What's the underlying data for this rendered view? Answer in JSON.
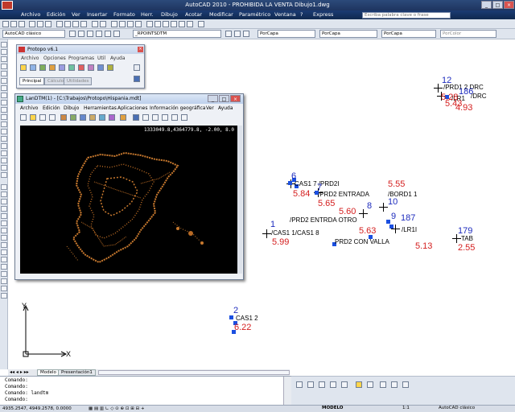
{
  "window": {
    "title": "AutoCAD 2010 - PROHIBIDA LA VENTA    Dibujo1.dwg",
    "search_placeholder": "Escriba palabra clave o frase"
  },
  "menu": [
    "Archivo",
    "Edición",
    "Ver",
    "Insertar",
    "Formato",
    "Herr.",
    "Dibujo",
    "Acotar",
    "Modificar",
    "Paramétrico",
    "Ventana",
    "?",
    "Express"
  ],
  "toolbar": {
    "workspace": "AutoCAD clásico",
    "layer": "_RPOINTSDTM",
    "layer_combo": "PorCapa",
    "linetype": "PorCapa",
    "lineweight": "PorCapa",
    "color": "PorColor"
  },
  "protopo": {
    "title": "Protopo v6.1",
    "menu": [
      "Archivo",
      "Opciones",
      "Programas",
      "Util",
      "Ayuda"
    ],
    "tabs": [
      "Principal",
      "Cálculo",
      "Utilidades"
    ]
  },
  "landtm": {
    "title": "LanDTM(1) - [C:\\Trabajos\\Protopo\\Hispania.mdt]",
    "menu": [
      "Archivo",
      "Edición",
      "Dibujo",
      "Herramientas",
      "Aplicaciones",
      "Información geográfica",
      "Ver",
      "Ayuda"
    ],
    "coords": "1333049.8,4364779.8,  -2.00,  8.0"
  },
  "drawing": {
    "labels": [
      {
        "id": "n12",
        "text": "12",
        "cls": "b"
      },
      {
        "id": "t_prd1",
        "text": "/PRD1 2 DRC",
        "cls": "k"
      },
      {
        "id": "n186",
        "text": "186",
        "cls": "b"
      },
      {
        "id": "t_drc",
        "text": "/DRC",
        "cls": "k"
      },
      {
        "id": "t_lr1",
        "text": "/LR1",
        "cls": "k"
      },
      {
        "id": "v528",
        "text": "5.28",
        "cls": "r"
      },
      {
        "id": "v543",
        "text": "5.43",
        "cls": "r"
      },
      {
        "id": "v493",
        "text": "4.93",
        "cls": "r"
      },
      {
        "id": "n6",
        "text": "6",
        "cls": "b"
      },
      {
        "id": "t_cas17",
        "text": "CAS1 7 /PRD2I",
        "cls": "k"
      },
      {
        "id": "n7",
        "text": "7",
        "cls": "b"
      },
      {
        "id": "v584",
        "text": "5.84",
        "cls": "r"
      },
      {
        "id": "t_entrada",
        "text": "/PRD2  ENTRADA",
        "cls": "k"
      },
      {
        "id": "v555",
        "text": "5.55",
        "cls": "r"
      },
      {
        "id": "t_bord",
        "text": "/BORD1 1",
        "cls": "k"
      },
      {
        "id": "v565",
        "text": "5.65",
        "cls": "r"
      },
      {
        "id": "n10",
        "text": "10",
        "cls": "b"
      },
      {
        "id": "n8",
        "text": "8",
        "cls": "b"
      },
      {
        "id": "v560",
        "text": "5.60",
        "cls": "r"
      },
      {
        "id": "n9",
        "text": "9",
        "cls": "b"
      },
      {
        "id": "n187",
        "text": "187",
        "cls": "b"
      },
      {
        "id": "t_otro",
        "text": "/PRD2 ENTRDA OTRO",
        "cls": "k"
      },
      {
        "id": "n1",
        "text": "1",
        "cls": "b"
      },
      {
        "id": "t_cas11",
        "text": "/CAS1 1/CAS1 8",
        "cls": "k"
      },
      {
        "id": "v563",
        "text": "5.63",
        "cls": "r"
      },
      {
        "id": "t_lr1i",
        "text": "/LR1I",
        "cls": "k"
      },
      {
        "id": "n179",
        "text": "179",
        "cls": "b"
      },
      {
        "id": "t_tab",
        "text": "TAB",
        "cls": "k"
      },
      {
        "id": "v599",
        "text": "5.99",
        "cls": "r"
      },
      {
        "id": "t_valla",
        "text": "PRD2 CON VALLA",
        "cls": "k"
      },
      {
        "id": "v513",
        "text": "5.13",
        "cls": "r"
      },
      {
        "id": "v255",
        "text": "2.55",
        "cls": "r"
      },
      {
        "id": "n2",
        "text": "2",
        "cls": "b"
      },
      {
        "id": "t_cas12",
        "text": "CAS1 2",
        "cls": "k"
      },
      {
        "id": "v622",
        "text": "6.22",
        "cls": "r"
      }
    ]
  },
  "ucs": {
    "x": "X",
    "y": "Y"
  },
  "layout_tabs": [
    "Modelo",
    "Presentación1"
  ],
  "command_lines": [
    "Comando:",
    "Comando:",
    "Comando: landtm",
    "Comando:"
  ],
  "status": {
    "coords": "4935.2547, 4949.2578, 0.0000",
    "model": "MODELO",
    "scale": "1:1",
    "workspace": "AutoCAD clásico"
  }
}
